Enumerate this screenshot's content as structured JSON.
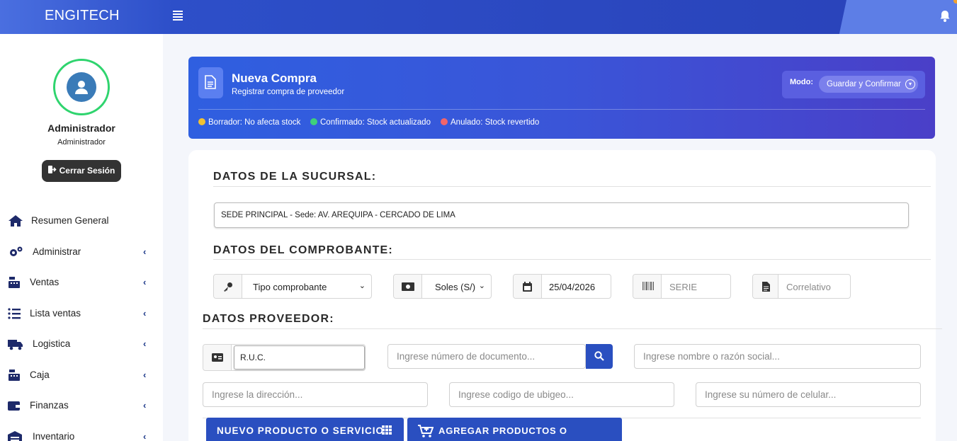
{
  "app": {
    "brand": "ENGITECH"
  },
  "user": {
    "name": "Administrador",
    "role": "Administrador",
    "logout_label": "Cerrar Sesión"
  },
  "sidebar": {
    "items": [
      {
        "label": "Resumen General",
        "icon": "home-icon"
      },
      {
        "label": "Administrar",
        "icon": "cogs-icon"
      },
      {
        "label": "Ventas",
        "icon": "cash-register-icon"
      },
      {
        "label": "Lista ventas",
        "icon": "list-icon"
      },
      {
        "label": "Logistica",
        "icon": "truck-icon"
      },
      {
        "label": "Caja",
        "icon": "cash-register-icon"
      },
      {
        "label": "Finanzas",
        "icon": "wallet-icon"
      },
      {
        "label": "Inventario",
        "icon": "warehouse-icon"
      }
    ]
  },
  "header": {
    "title": "Nueva Compra",
    "subtitle": "Registrar compra de proveedor",
    "mode_label": "Modo:",
    "mode_value": "Guardar y Confirmar",
    "legend": [
      {
        "label": "Borrador: No afecta stock",
        "color": "#f2c232"
      },
      {
        "label": "Confirmado: Stock actualizado",
        "color": "#3fd07a"
      },
      {
        "label": "Anulado: Stock revertido",
        "color": "#f2656a"
      }
    ]
  },
  "branch": {
    "section_title": "DATOS DE LA SUCURSAL:",
    "value": "SEDE PRINCIPAL - Sede: AV. AREQUIPA - CERCADO DE LIMA"
  },
  "voucher": {
    "section_title": "DATOS DEL COMPROBANTE:",
    "type_value": "Tipo comprobante",
    "currency_value": "Soles (S/)",
    "date_value": "25/04/2026",
    "serie_placeholder": "SERIE",
    "correlativo_placeholder": "Correlativo"
  },
  "supplier": {
    "section_title": "DATOS PROVEEDOR:",
    "doc_type": "R.U.C.",
    "doc_number_placeholder": "Ingrese número de documento...",
    "name_placeholder": "Ingrese nombre o razón social...",
    "address_placeholder": "Ingrese la dirección...",
    "ubigeo_placeholder": "Ingrese codigo de ubigeo...",
    "phone_placeholder": "Ingrese su número de celular..."
  },
  "actions": {
    "new_product": "NUEVO PRODUCTO O SERVICIO",
    "add_products": "AGREGAR PRODUCTOS O SERVICIOS"
  }
}
